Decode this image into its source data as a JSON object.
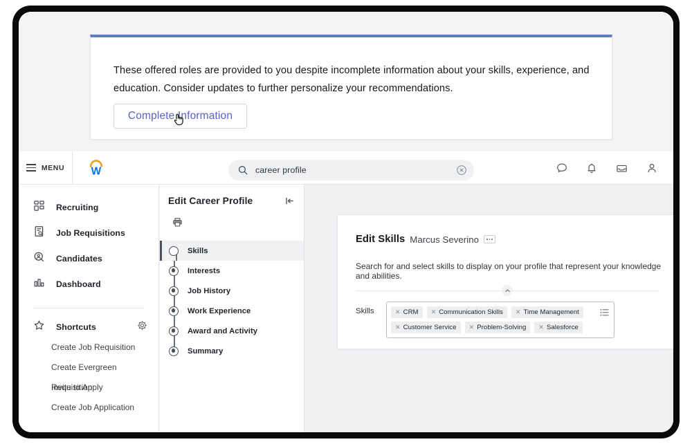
{
  "notification": {
    "message": "These offered roles are provided to you despite incomplete information about your skills, experience, and education. Consider updates to further personalize your recommendations.",
    "button_label": "Complete Information",
    "accent_color": "#5b7fbd",
    "button_text_color": "#5b5fc7"
  },
  "header": {
    "menu_label": "MENU",
    "logo_name": "workday-logo",
    "logo_colors": {
      "arc": "#f0a01e",
      "letter": "#0875e1"
    },
    "search": {
      "value": "career profile",
      "placeholder": "Search",
      "icon": "search-icon",
      "clear_icon": "clear-circle-icon"
    },
    "icons": [
      {
        "name": "chat-icon"
      },
      {
        "name": "notifications-bell-icon"
      },
      {
        "name": "inbox-icon"
      },
      {
        "name": "profile-person-icon"
      }
    ]
  },
  "sidebar": {
    "items": [
      {
        "label": "Recruiting",
        "icon": "grid-squares-icon"
      },
      {
        "label": "Job Requisitions",
        "icon": "document-search-icon"
      },
      {
        "label": "Candidates",
        "icon": "magnifier-person-icon"
      },
      {
        "label": "Dashboard",
        "icon": "bar-chart-icon"
      }
    ],
    "shortcuts": {
      "label": "Shortcuts",
      "star_icon": "star-icon",
      "settings_icon": "gear-icon",
      "links": [
        "Create Job Requisition",
        "Create Evergreen Requisition",
        "Invite to Apply",
        "Create Job Application"
      ]
    }
  },
  "task_panel": {
    "title": "Edit Career Profile",
    "collapse_icon": "collapse-panel-icon",
    "print_icon": "print-icon",
    "steps": [
      {
        "label": "Skills",
        "active": true
      },
      {
        "label": "Interests",
        "active": false
      },
      {
        "label": "Job History",
        "active": false
      },
      {
        "label": "Work Experience",
        "active": false
      },
      {
        "label": "Award and Activity",
        "active": false
      },
      {
        "label": "Summary",
        "active": false
      }
    ]
  },
  "main": {
    "card_title": "Edit Skills",
    "card_subject": "Marcus Severino",
    "related_actions_icon": "ellipsis-icon",
    "description": "Search for and select skills to display on your profile that represent your knowledge and abilities.",
    "collapse_chevron_icon": "chevron-up-icon",
    "field_label": "Skills",
    "list_icon": "list-menu-icon",
    "skills": [
      "CRM",
      "Communication Skills",
      "Time Management",
      "Customer Service",
      "Problem-Solving",
      "Salesforce"
    ]
  }
}
